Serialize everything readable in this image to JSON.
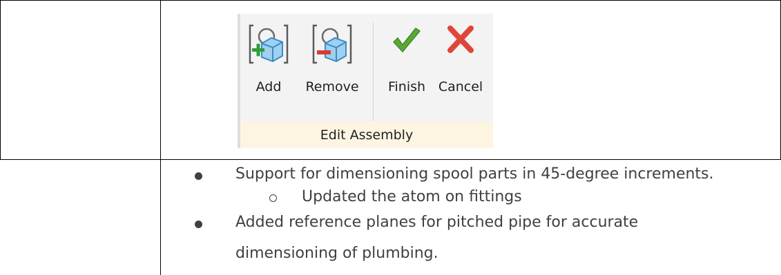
{
  "ribbon": {
    "buttons": [
      {
        "label": "Add"
      },
      {
        "label": "Remove"
      },
      {
        "label": "Finish"
      },
      {
        "label": "Cancel"
      }
    ],
    "group_label": "Edit Assembly",
    "colors": {
      "panel": "#f3f3f3",
      "group_bar": "#fdf5e2",
      "finish_icon": "#5aa838",
      "cancel_icon": "#e0453a",
      "add_plus": "#2e9d3c",
      "remove_minus": "#d93a32"
    }
  },
  "bullets": [
    {
      "text": "Support for dimensioning spool parts in 45-degree increments.",
      "level": 1
    },
    {
      "text": "Updated the atom on fittings",
      "level": 2
    },
    {
      "text": "Added reference planes for pitched pipe for accurate",
      "level": 1
    },
    {
      "text": "dimensioning of plumbing.",
      "level": 1,
      "continuation": true
    }
  ]
}
